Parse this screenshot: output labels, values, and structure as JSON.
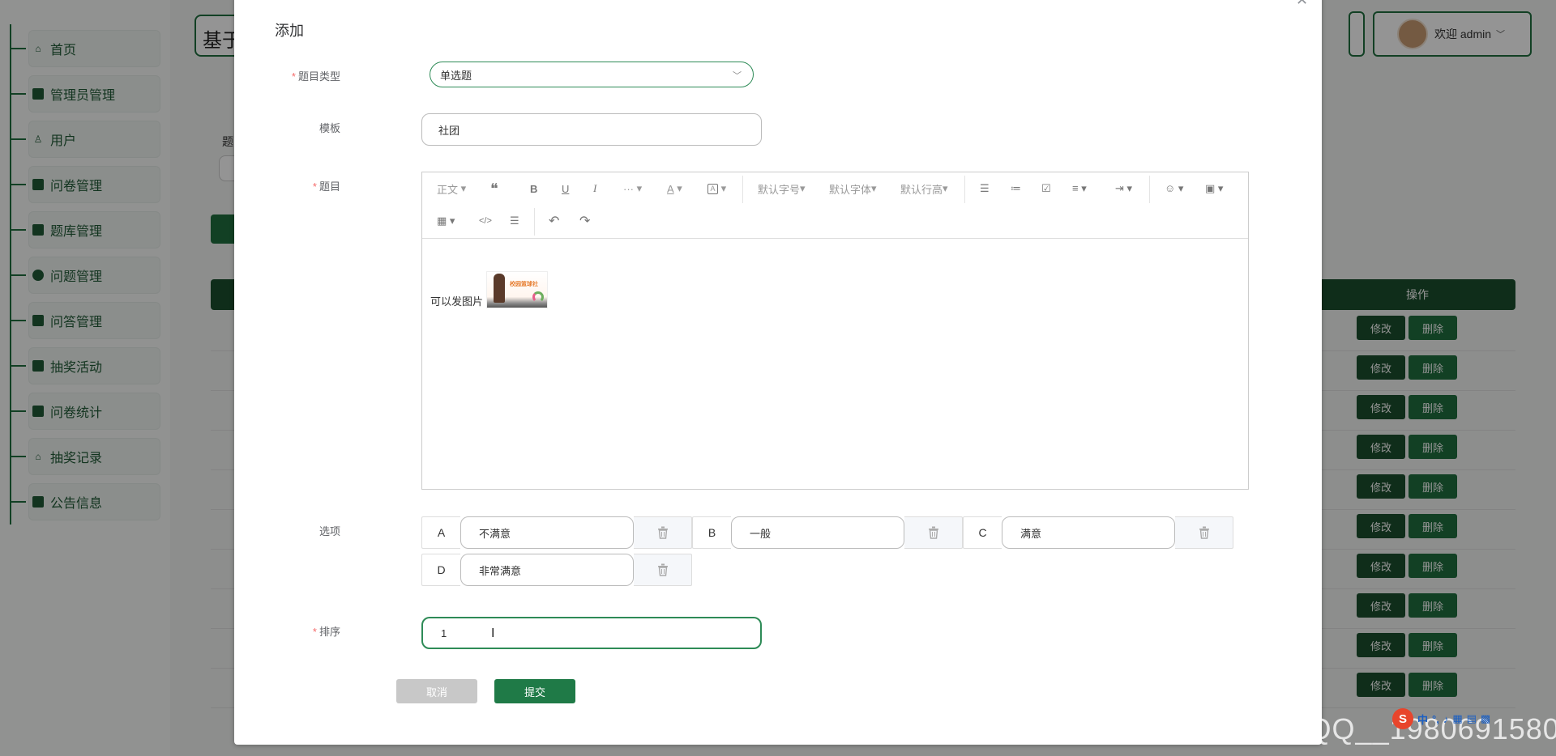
{
  "sidebar": {
    "items": [
      {
        "label": "首页",
        "icon": "home-icon",
        "glyph": "⌂"
      },
      {
        "label": "管理员管理",
        "icon": "book-icon",
        "glyph": ""
      },
      {
        "label": "用户",
        "icon": "user-icon",
        "glyph": "♙"
      },
      {
        "label": "问卷管理",
        "icon": "survey-icon",
        "glyph": ""
      },
      {
        "label": "题库管理",
        "icon": "database-icon",
        "glyph": ""
      },
      {
        "label": "问题管理",
        "icon": "compass-icon",
        "glyph": ""
      },
      {
        "label": "问答管理",
        "icon": "notebook-icon",
        "glyph": ""
      },
      {
        "label": "抽奖活动",
        "icon": "server-icon",
        "glyph": ""
      },
      {
        "label": "问卷统计",
        "icon": "list-icon",
        "glyph": ""
      },
      {
        "label": "抽奖记录",
        "icon": "bank-icon",
        "glyph": "⌂"
      },
      {
        "label": "公告信息",
        "icon": "grid-icon",
        "glyph": ""
      }
    ]
  },
  "header": {
    "title_partial": "基于",
    "user_greeting": "欢迎 admin"
  },
  "background": {
    "filter_label_partial": "题",
    "table_action_header": "操作",
    "row_edit_label": "修改",
    "row_delete_label": "删除",
    "row_count": 10
  },
  "dialog": {
    "title": "添加",
    "fields": {
      "type": {
        "label": "题目类型",
        "value": "单选题",
        "required": true
      },
      "template": {
        "label": "模板",
        "value": "社团"
      },
      "question": {
        "label": "题目",
        "required": true,
        "content_text": "可以发图片",
        "image_caption": "校园篮球社"
      },
      "options": {
        "label": "选项",
        "items": [
          {
            "letter": "A",
            "value": "不满意"
          },
          {
            "letter": "B",
            "value": "一般"
          },
          {
            "letter": "C",
            "value": "满意"
          },
          {
            "letter": "D",
            "value": "非常满意"
          }
        ]
      },
      "sort": {
        "label": "排序",
        "value": "1",
        "required": true
      }
    },
    "toolbar": {
      "paragraph": "正文",
      "more": "···",
      "font_color": "A",
      "font_size": "默认字号",
      "font_family": "默认字体",
      "line_height": "默认行高"
    },
    "buttons": {
      "cancel": "取消",
      "submit": "提交"
    }
  },
  "ime": {
    "lang": "中"
  },
  "watermark": "CSDN @QQ__1980691580"
}
